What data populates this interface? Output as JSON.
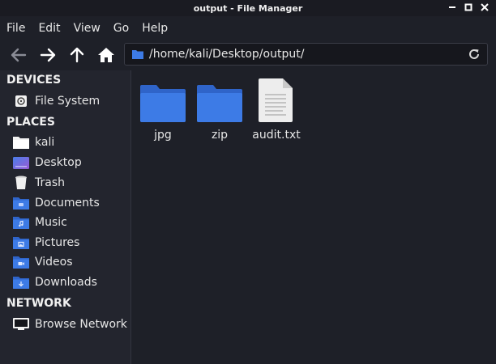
{
  "window": {
    "title": "output - File Manager"
  },
  "menu": [
    "File",
    "Edit",
    "View",
    "Go",
    "Help"
  ],
  "location": {
    "path": "/home/kali/Desktop/output/"
  },
  "sidebar": {
    "devices_title": "DEVICES",
    "devices": [
      {
        "label": "File System",
        "icon": "drive-icon"
      }
    ],
    "places_title": "PLACES",
    "places": [
      {
        "label": "kali",
        "icon": "home-folder-icon"
      },
      {
        "label": "Desktop",
        "icon": "desktop-icon"
      },
      {
        "label": "Trash",
        "icon": "trash-icon"
      },
      {
        "label": "Documents",
        "icon": "documents-folder-icon"
      },
      {
        "label": "Music",
        "icon": "music-folder-icon"
      },
      {
        "label": "Pictures",
        "icon": "pictures-folder-icon"
      },
      {
        "label": "Videos",
        "icon": "videos-folder-icon"
      },
      {
        "label": "Downloads",
        "icon": "downloads-folder-icon"
      }
    ],
    "network_title": "NETWORK",
    "network": [
      {
        "label": "Browse Network",
        "icon": "network-icon"
      }
    ]
  },
  "files": [
    {
      "name": "jpg",
      "type": "folder"
    },
    {
      "name": "zip",
      "type": "folder"
    },
    {
      "name": "audit.txt",
      "type": "text-file"
    }
  ],
  "colors": {
    "folder": "#3d7be6",
    "folder_tab": "#2f64c9",
    "background": "#1e2028",
    "sidebar": "#23252e"
  }
}
